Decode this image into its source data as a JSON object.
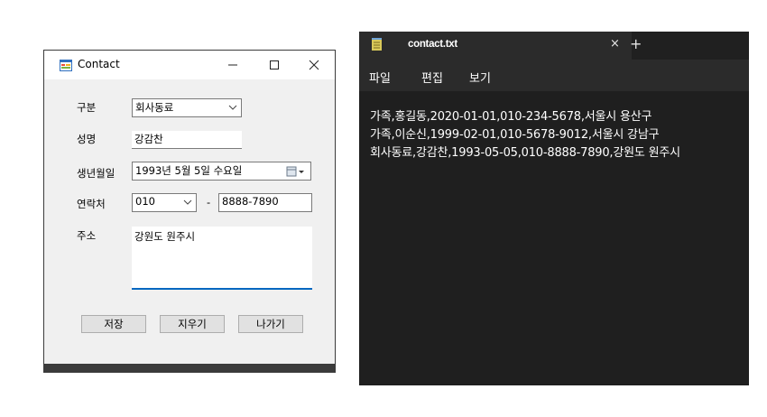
{
  "dialog": {
    "title": "Contact",
    "icon": "app-form-icon",
    "caption_buttons": {
      "minimize": "minimize-icon",
      "maximize": "maximize-icon",
      "close": "close-icon"
    },
    "labels": {
      "category": "구분",
      "name": "성명",
      "birthdate": "생년월일",
      "phone": "연락처",
      "address": "주소"
    },
    "category_select": {
      "value": "회사동료"
    },
    "name_input": {
      "value": "강감찬"
    },
    "birthdate_picker": {
      "value": "1993년  5월  5일 수요일"
    },
    "phone": {
      "prefix_value": "010",
      "separator": "-",
      "number_value": "8888-7890"
    },
    "address_textarea": {
      "value": "강원도 원주시"
    },
    "buttons": {
      "save": "저장",
      "clear": "지우기",
      "exit": "나가기"
    }
  },
  "notepad": {
    "tab_title": "contact.txt",
    "tab_close": "×",
    "new_tab": "+",
    "menu": [
      "파일",
      "편집",
      "보기"
    ],
    "lines": [
      "가족,홍길동,2020-01-01,010-234-5678,서울시 용산구",
      "가족,이순신,1999-02-01,010-5678-9012,서울시 강남구",
      "회사동료,강감찬,1993-05-05,010-8888-7890,강원도 원주시"
    ],
    "colors": {
      "background": "#1f1f1f",
      "tab": "#2b2b2b",
      "icon": "#d9c95a"
    }
  },
  "colors": {
    "dialog_background": "#f0f0f0",
    "dialog_frame": "#3b3b3b",
    "address_underline": "#0067c0"
  }
}
